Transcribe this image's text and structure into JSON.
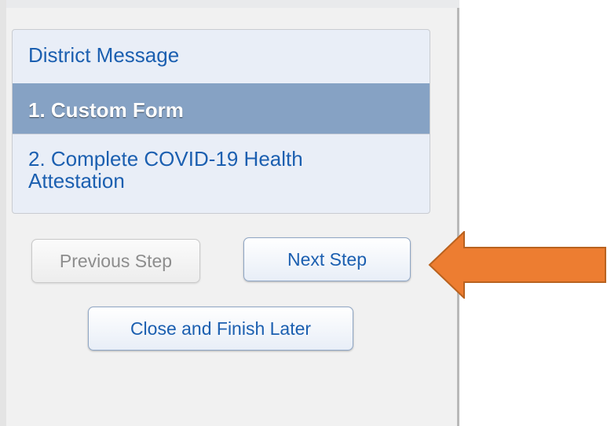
{
  "steps": {
    "district_message": "District Message",
    "custom_form": "1. Custom Form",
    "covid_line1": "2. Complete COVID-19 Health",
    "covid_line2": "Attestation"
  },
  "buttons": {
    "previous_step": "Previous Step",
    "next_step": "Next Step",
    "close_and_finish_later": "Close and Finish Later"
  },
  "colors": {
    "accent_text": "#1b5fb0",
    "selected_step_bg": "#86a2c4",
    "arrow_fill": "#ed7d31"
  },
  "icons": {
    "pointer": "arrow-left-icon"
  }
}
